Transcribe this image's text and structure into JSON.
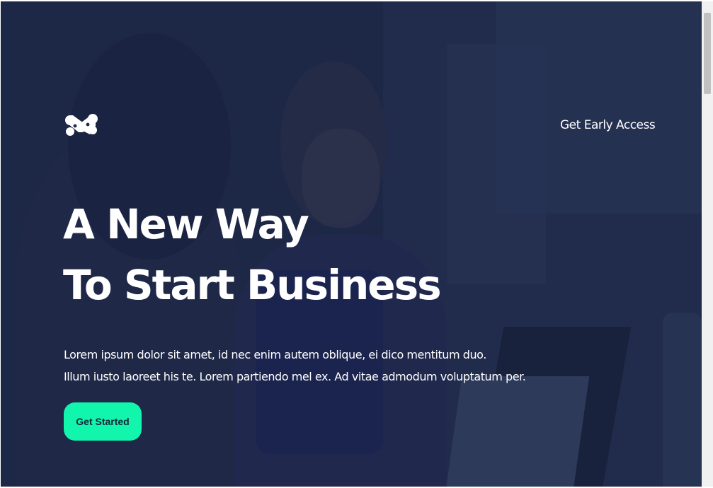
{
  "header": {
    "logo_icon": "abstract-n-logo-icon",
    "nav_link": "Get Early Access"
  },
  "hero": {
    "title_line1": "A New Way",
    "title_line2": "To Start Business",
    "text_line1": "Lorem ipsum dolor sit amet, id nec enim autem oblique, ei dico mentitum duo.",
    "text_line2": "Illum iusto laoreet his te. Lorem partiendo mel ex. Ad vitae admodum voluptatum per.",
    "cta_label": "Get Started"
  },
  "colors": {
    "overlay": "#1a2448",
    "accent": "#12f5ad",
    "text": "#ffffff"
  }
}
